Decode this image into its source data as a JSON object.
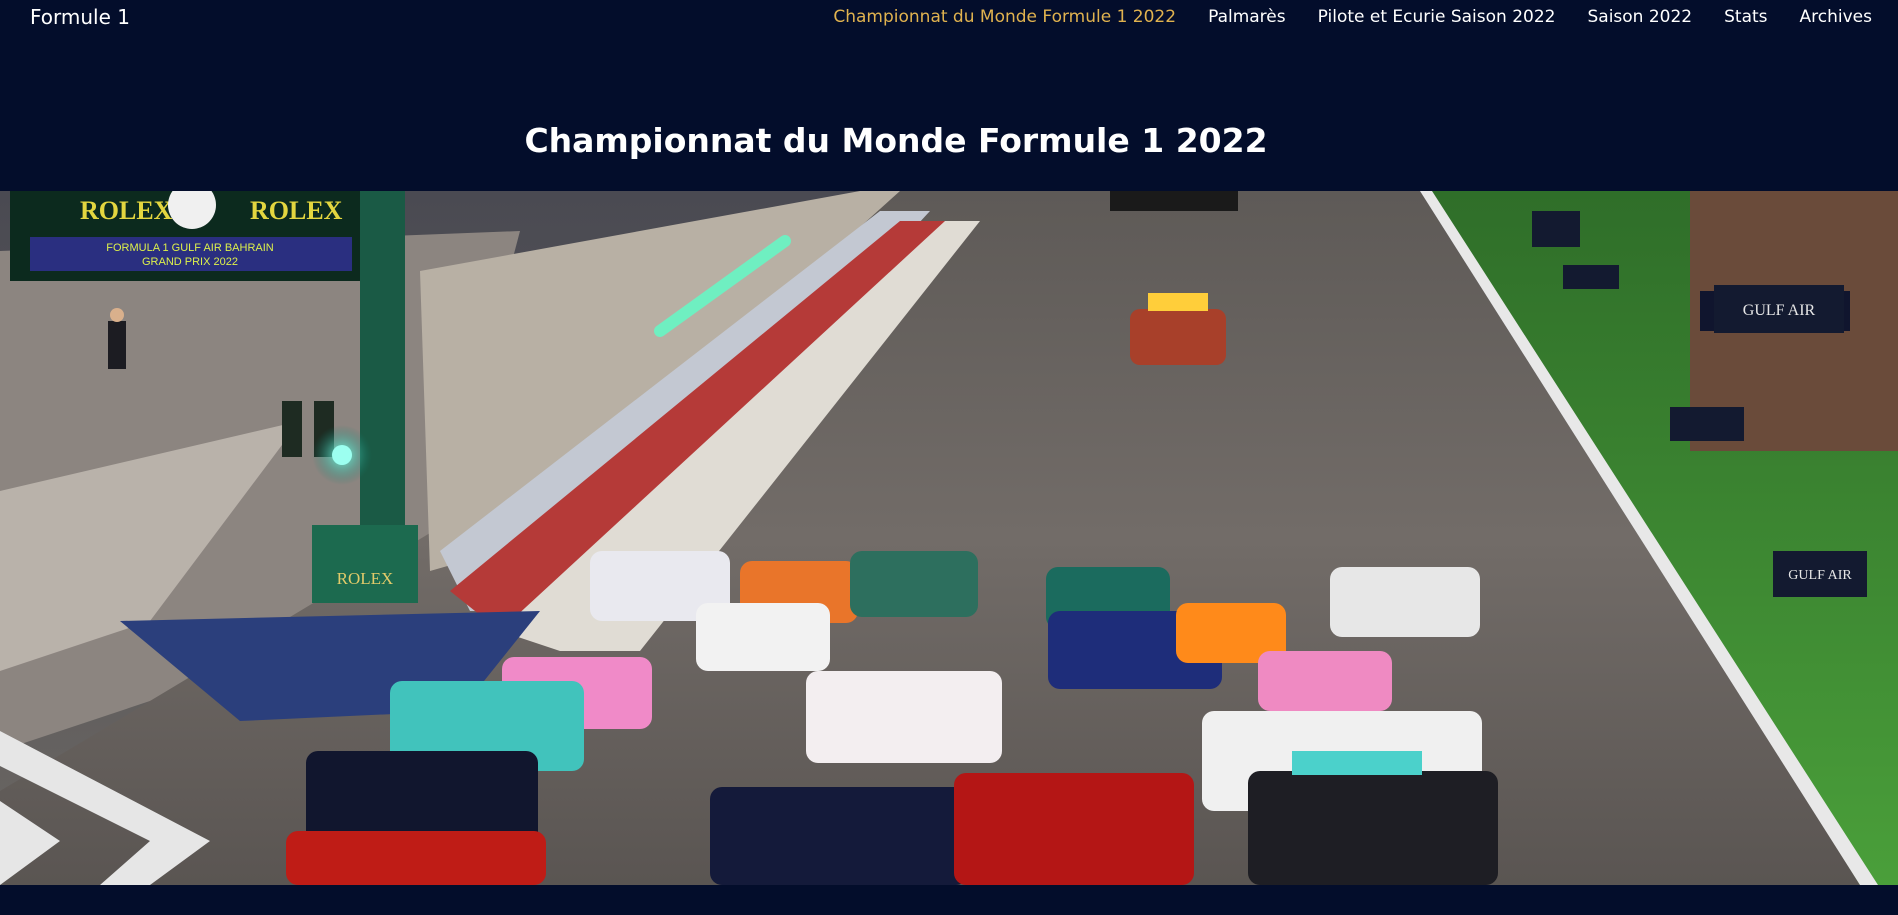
{
  "navbar": {
    "brand": "Formule 1",
    "links": [
      {
        "label": "Championnat du Monde Formule 1 2022",
        "active": true
      },
      {
        "label": "Palmarès",
        "active": false
      },
      {
        "label": "Pilote et Ecurie Saison 2022",
        "active": false
      },
      {
        "label": "Saison 2022",
        "active": false
      },
      {
        "label": "Stats",
        "active": false
      },
      {
        "label": "Archives",
        "active": false
      }
    ]
  },
  "main": {
    "title": "Championnat du Monde Formule 1 2022"
  },
  "hero": {
    "signage": {
      "rolex_left": "ROLEX",
      "rolex_right": "ROLEX",
      "screen_line1": "FORMULA 1 GULF AIR BAHRAIN",
      "screen_line2": "GRAND PRIX 2022",
      "rolex_box": "ROLEX",
      "gulf_air_1": "GULF AIR",
      "gulf_air_2": "GULF AIR"
    }
  },
  "colors": {
    "background": "#030d2b",
    "accent": "#e0b24f",
    "text": "#ffffff"
  }
}
